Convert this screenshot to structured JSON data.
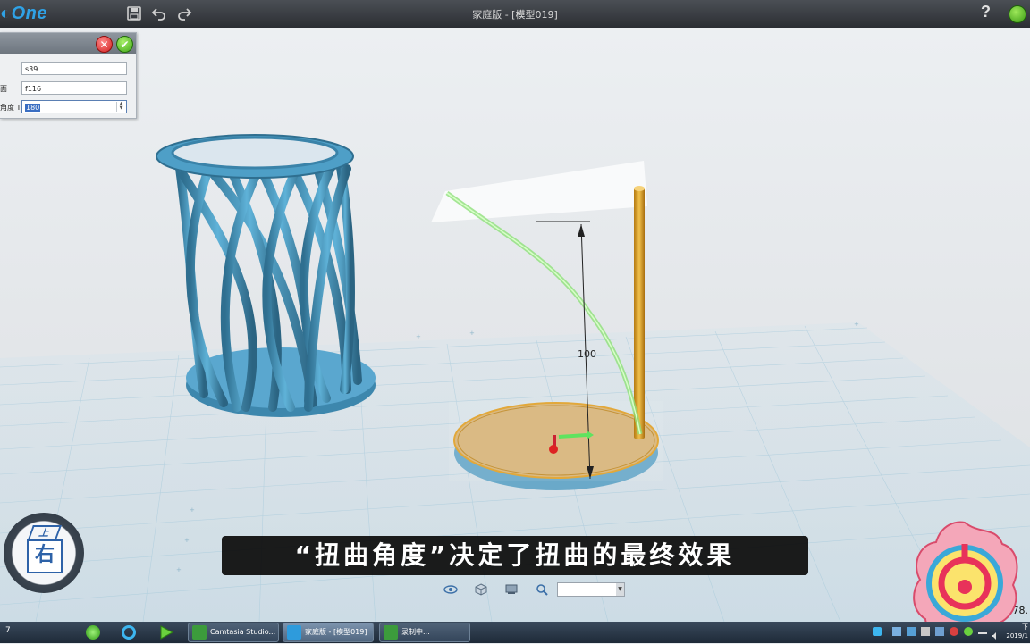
{
  "app": {
    "logo_text": "One",
    "window_title": "家庭版 - [模型019]",
    "help_label": "?"
  },
  "panel": {
    "rows": [
      {
        "label": "",
        "value": "s39"
      },
      {
        "label": "面",
        "value": "f116"
      },
      {
        "label": "角度 T",
        "value": "180"
      }
    ]
  },
  "viewport": {
    "dimension_label": "100",
    "subtitle": "“扭曲角度”决定了扭曲的最终效果",
    "viewcube": {
      "front_label": "右",
      "top_label": "上"
    },
    "coordinate_readout": "278."
  },
  "taskbar": {
    "left_number": "7",
    "tasks": [
      {
        "label": "Camtasia Studio..."
      },
      {
        "label": "家庭版 - [模型019]"
      },
      {
        "label": "录制中..."
      }
    ],
    "clock_lines": [
      "下",
      "2019/1"
    ]
  },
  "colors": {
    "model_blue": "#4a9ac2",
    "plate_gold": "#d7b57a",
    "rod_orange": "#e0a12a",
    "helix_green": "#8fe07a"
  }
}
